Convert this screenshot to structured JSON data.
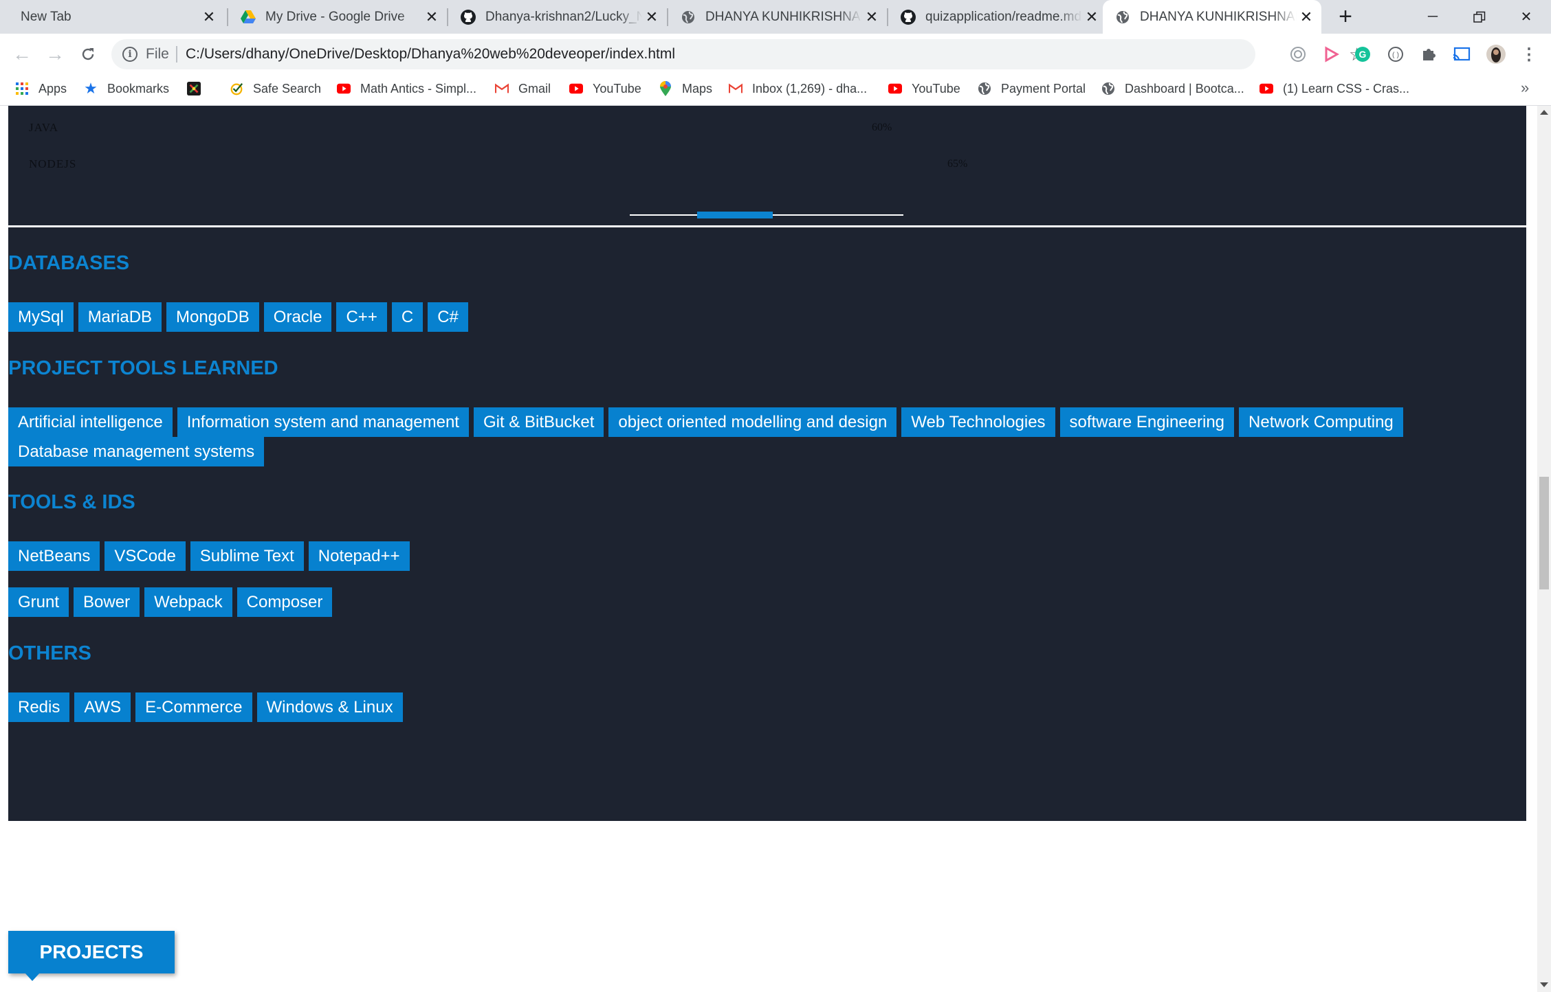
{
  "browser": {
    "tabs": [
      {
        "title": "New Tab",
        "icon": "none"
      },
      {
        "title": "My Drive - Google Drive",
        "icon": "google-drive-icon"
      },
      {
        "title": "Dhanya-krishnan2/Lucky_N",
        "icon": "github-icon"
      },
      {
        "title": "DHANYA KUNHIKRISHNAN|",
        "icon": "globe-icon"
      },
      {
        "title": "quizapplication/readme.md",
        "icon": "github-icon"
      },
      {
        "title": "DHANYA KUNHIKRISHNAN|",
        "icon": "globe-icon",
        "active": true
      }
    ],
    "omnibox": {
      "scheme_label": "File",
      "url": "C:/Users/dhany/OneDrive/Desktop/Dhanya%20web%20deveoper/index.html"
    },
    "bookmarks": [
      {
        "label": "Apps",
        "icon": "apps-grid-icon"
      },
      {
        "label": "Bookmarks",
        "icon": "star-icon"
      },
      {
        "label": "",
        "icon": "colorful-x-icon"
      },
      {
        "label": "Safe Search",
        "icon": "safe-search-icon"
      },
      {
        "label": "Math Antics - Simpl...",
        "icon": "youtube-icon"
      },
      {
        "label": "Gmail",
        "icon": "gmail-icon"
      },
      {
        "label": "YouTube",
        "icon": "youtube-icon"
      },
      {
        "label": "Maps",
        "icon": "maps-pin-icon"
      },
      {
        "label": "Inbox (1,269) - dha...",
        "icon": "gmail-icon"
      },
      {
        "label": "YouTube",
        "icon": "youtube-icon"
      },
      {
        "label": "Payment Portal",
        "icon": "globe-icon"
      },
      {
        "label": "Dashboard | Bootca...",
        "icon": "globe-icon"
      },
      {
        "label": "(1) Learn CSS - Cras...",
        "icon": "youtube-icon"
      }
    ],
    "bookmarks_overflow": "»"
  },
  "skills": [
    {
      "name": "JAVA",
      "percent": "60%"
    },
    {
      "name": "NODEJS",
      "percent": "65%"
    }
  ],
  "sections": [
    {
      "title": "DATABASES",
      "rows": [
        [
          "MySql",
          "MariaDB",
          "MongoDB",
          "Oracle",
          "C++",
          "C",
          "C#"
        ]
      ]
    },
    {
      "title": "PROJECT TOOLS LEARNED",
      "rows": [
        [
          "Artificial intelligence",
          "Information system and management",
          "Git & BitBucket",
          "object oriented modelling and design",
          "Web Technologies",
          "software Engineering",
          "Network Computing",
          "Database management systems"
        ]
      ]
    },
    {
      "title": "TOOLS & IDS",
      "rows": [
        [
          "NetBeans",
          "VSCode",
          "Sublime Text",
          "Notepad++"
        ],
        [
          "Grunt",
          "Bower",
          "Webpack",
          "Composer"
        ]
      ]
    },
    {
      "title": "OTHERS",
      "rows": [
        [
          "Redis",
          "AWS",
          "E-Commerce",
          "Windows & Linux"
        ]
      ]
    }
  ],
  "projects_label": "PROJECTS",
  "colors": {
    "page_dark": "#1d2330",
    "accent": "#0781cf",
    "heading": "#0c84d1"
  }
}
